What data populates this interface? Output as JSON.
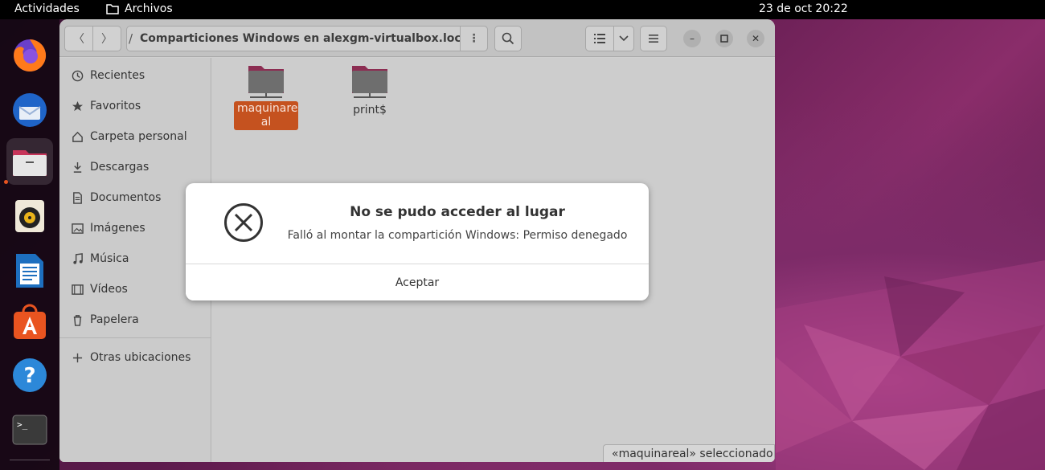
{
  "topbar": {
    "activities": "Actividades",
    "app_name": "Archivos",
    "clock": "23 de oct  20:22"
  },
  "dock": {
    "items": [
      "firefox-icon",
      "thunderbird-icon",
      "files-icon",
      "rhythmbox-icon",
      "libreoffice-writer-icon",
      "software-icon",
      "help-icon",
      "terminal-icon"
    ],
    "active": "files-icon"
  },
  "window": {
    "path": "Comparticiones Windows en alexgm-virtualbox.local",
    "sidebar": {
      "items": [
        {
          "label": "Recientes",
          "icon": "clock-icon"
        },
        {
          "label": "Favoritos",
          "icon": "star-icon"
        },
        {
          "label": "Carpeta personal",
          "icon": "home-icon"
        },
        {
          "label": "Descargas",
          "icon": "download-icon"
        },
        {
          "label": "Documentos",
          "icon": "document-icon"
        },
        {
          "label": "Imágenes",
          "icon": "image-icon"
        },
        {
          "label": "Música",
          "icon": "music-icon"
        },
        {
          "label": "Vídeos",
          "icon": "video-icon"
        },
        {
          "label": "Papelera",
          "icon": "trash-icon"
        }
      ],
      "other": {
        "label": "Otras ubicaciones",
        "icon": "plus-icon"
      }
    },
    "files": [
      {
        "name": "maquinareal",
        "label_line1": "maquinare",
        "label_line2": "al",
        "selected": true
      },
      {
        "name": "print$",
        "label_line1": "print$",
        "selected": false
      }
    ],
    "status": "«maquinareal» seleccionado"
  },
  "dialog": {
    "title": "No se pudo acceder al lugar",
    "message": "Falló al montar la compartición Windows: Permiso denegado",
    "accept": "Aceptar"
  },
  "colors": {
    "accent": "#e95420",
    "selection": "#c5521f",
    "folder_top": "#8c2d52",
    "folder_body": "#6e6e6e"
  }
}
